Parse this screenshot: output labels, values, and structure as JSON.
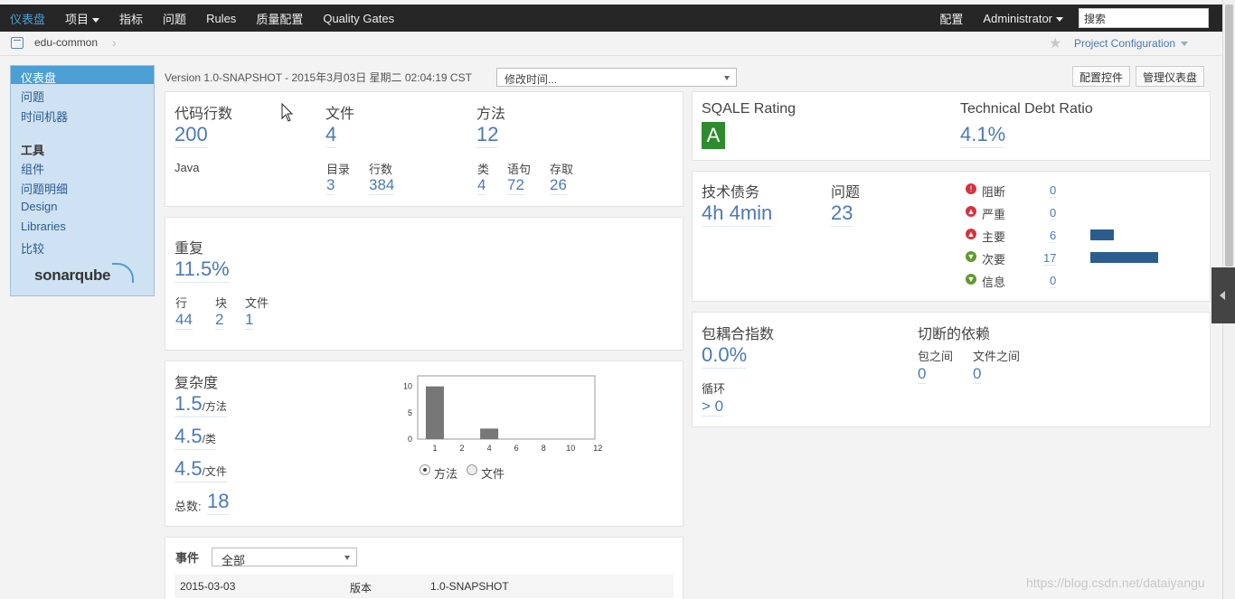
{
  "topnav": {
    "items": [
      "仪表盘",
      "项目",
      "指标",
      "问题",
      "Rules",
      "质量配置",
      "Quality Gates"
    ],
    "right_items": [
      "配置",
      "Administrator"
    ],
    "search_placeholder": "搜索"
  },
  "breadcrumb": {
    "project": "edu-common",
    "project_config": "Project Configuration"
  },
  "sidebar": {
    "items": [
      "仪表盘",
      "问题",
      "时间机器"
    ],
    "tools_heading": "工具",
    "tools": [
      "组件",
      "问题明细",
      "Design",
      "Libraries",
      "比较"
    ],
    "logo_text": "sonarqube"
  },
  "version_bar": {
    "text": "Version 1.0-SNAPSHOT - 2015年3月03日 星期二 02:04:19 CST",
    "period_select": "修改时间...",
    "configure_button": "配置控件",
    "manage_button": "管理仪表盘"
  },
  "size": {
    "loc_label": "代码行数",
    "loc_value": "200",
    "language": "Java",
    "files_label": "文件",
    "files_value": "4",
    "dirs_label": "目录",
    "dirs_value": "3",
    "lines_label": "行数",
    "lines_value": "384",
    "functions_label": "方法",
    "functions_value": "12",
    "classes_label": "类",
    "classes_value": "4",
    "statements_label": "语句",
    "statements_value": "72",
    "accessors_label": "存取",
    "accessors_value": "26"
  },
  "duplication": {
    "label": "重复",
    "value": "11.5%",
    "lines_label": "行",
    "lines_value": "44",
    "blocks_label": "块",
    "blocks_value": "2",
    "files_label": "文件",
    "files_value": "1"
  },
  "complexity": {
    "label": "复杂度",
    "per_function": "1.5",
    "per_function_unit": "/方法",
    "per_class": "4.5",
    "per_class_unit": "/类",
    "per_file": "4.5",
    "per_file_unit": "/文件",
    "total_label": "总数:",
    "total_value": "18",
    "radio_function": "方法",
    "radio_file": "文件"
  },
  "chart_data": {
    "type": "bar",
    "categories": [
      "1",
      "2",
      "4",
      "6",
      "8",
      "10",
      "12"
    ],
    "values": [
      10,
      0,
      2,
      0,
      0,
      0,
      0
    ],
    "yticks": [
      "0",
      "5",
      "10"
    ],
    "ylim": [
      0,
      12
    ]
  },
  "sqale": {
    "rating_label": "SQALE Rating",
    "rating_value": "A",
    "debt_ratio_label": "Technical Debt Ratio",
    "debt_ratio_value": "4.1%"
  },
  "issues": {
    "debt_label": "技术债务",
    "debt_value": "4h 4min",
    "issues_label": "问题",
    "issues_value": "23",
    "severities": [
      {
        "label": "阻断",
        "count": "0",
        "icon": "blocker-icon",
        "color": "#d4333f",
        "fraction": 0
      },
      {
        "label": "严重",
        "count": "0",
        "icon": "critical-icon",
        "color": "#d4333f",
        "fraction": 0
      },
      {
        "label": "主要",
        "count": "6",
        "icon": "major-icon",
        "color": "#d4333f",
        "fraction": 0.353
      },
      {
        "label": "次要",
        "count": "17",
        "icon": "minor-icon",
        "color": "#5f9a2f",
        "fraction": 1
      },
      {
        "label": "信息",
        "count": "0",
        "icon": "info-icon",
        "color": "#5f9a2f",
        "fraction": 0
      }
    ]
  },
  "design": {
    "tangle_label": "包耦合指数",
    "tangle_value": "0.0%",
    "cycles_label": "循环",
    "cycles_value": "> 0",
    "cuts_label": "切断的依赖",
    "between_packages_label": "包之间",
    "between_packages_value": "0",
    "between_files_label": "文件之间",
    "between_files_value": "0"
  },
  "events": {
    "label": "事件",
    "filter": "全部",
    "rows": [
      {
        "date": "2015-03-03",
        "type": "版本",
        "name": "1.0-SNAPSHOT"
      }
    ]
  },
  "watermark": "https://blog.csdn.net/dataiyangu",
  "colors": {
    "accent": "#4b9fd5",
    "link": "#4b7ab3",
    "rating_a": "#2e8b2e",
    "bar": "#2c5d8f"
  }
}
